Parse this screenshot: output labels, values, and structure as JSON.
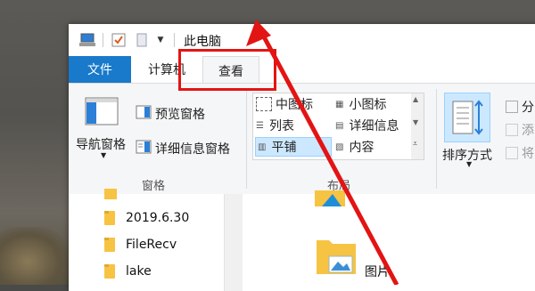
{
  "window": {
    "title": "此电脑"
  },
  "tabs": {
    "file": "文件",
    "computer": "计算机",
    "view": "查看"
  },
  "ribbon": {
    "panes_group": {
      "label": "窗格",
      "nav_pane": "导航窗格",
      "preview_pane": "预览窗格",
      "details_pane": "详细信息窗格"
    },
    "layout_group": {
      "label": "布局",
      "medium_icons": "中图标",
      "small_icons": "小图标",
      "list": "列表",
      "details": "详细信息",
      "tiles": "平铺",
      "content": "内容"
    },
    "current_view": {
      "sort_by": "排序方式",
      "group_by_partial": "分",
      "add_columns_partial": "添",
      "size_columns_partial": "将"
    }
  },
  "nav": {
    "items": [
      {
        "label": "2019.6.30"
      },
      {
        "label": "FileRecv"
      },
      {
        "label": "lake"
      }
    ]
  },
  "main": {
    "pictures": "图片"
  },
  "colors": {
    "file_tab": "#1979ca",
    "highlight": "#e31414",
    "selected_layout": "#cce8ff"
  }
}
